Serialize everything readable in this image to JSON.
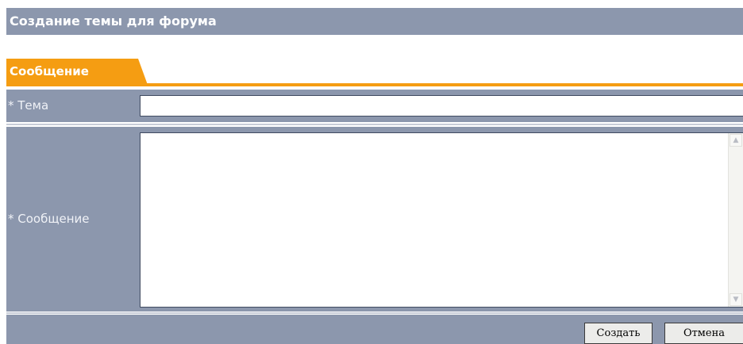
{
  "header": {
    "title": "Создание темы для форума"
  },
  "tabs": [
    {
      "label": "Сообщение"
    }
  ],
  "form": {
    "subject_label": "* Тема",
    "subject_value": "",
    "message_label": "* Сообщение",
    "message_value": ""
  },
  "buttons": {
    "create_label": "Создать",
    "cancel_label": "Отмена"
  },
  "icons": {
    "scroll_up": "scroll-up-icon",
    "scroll_down": "scroll-down-icon"
  },
  "colors": {
    "header_bg": "#8c97ad",
    "tab_accent": "#f59d12",
    "label_text": "#f0f2f7"
  }
}
